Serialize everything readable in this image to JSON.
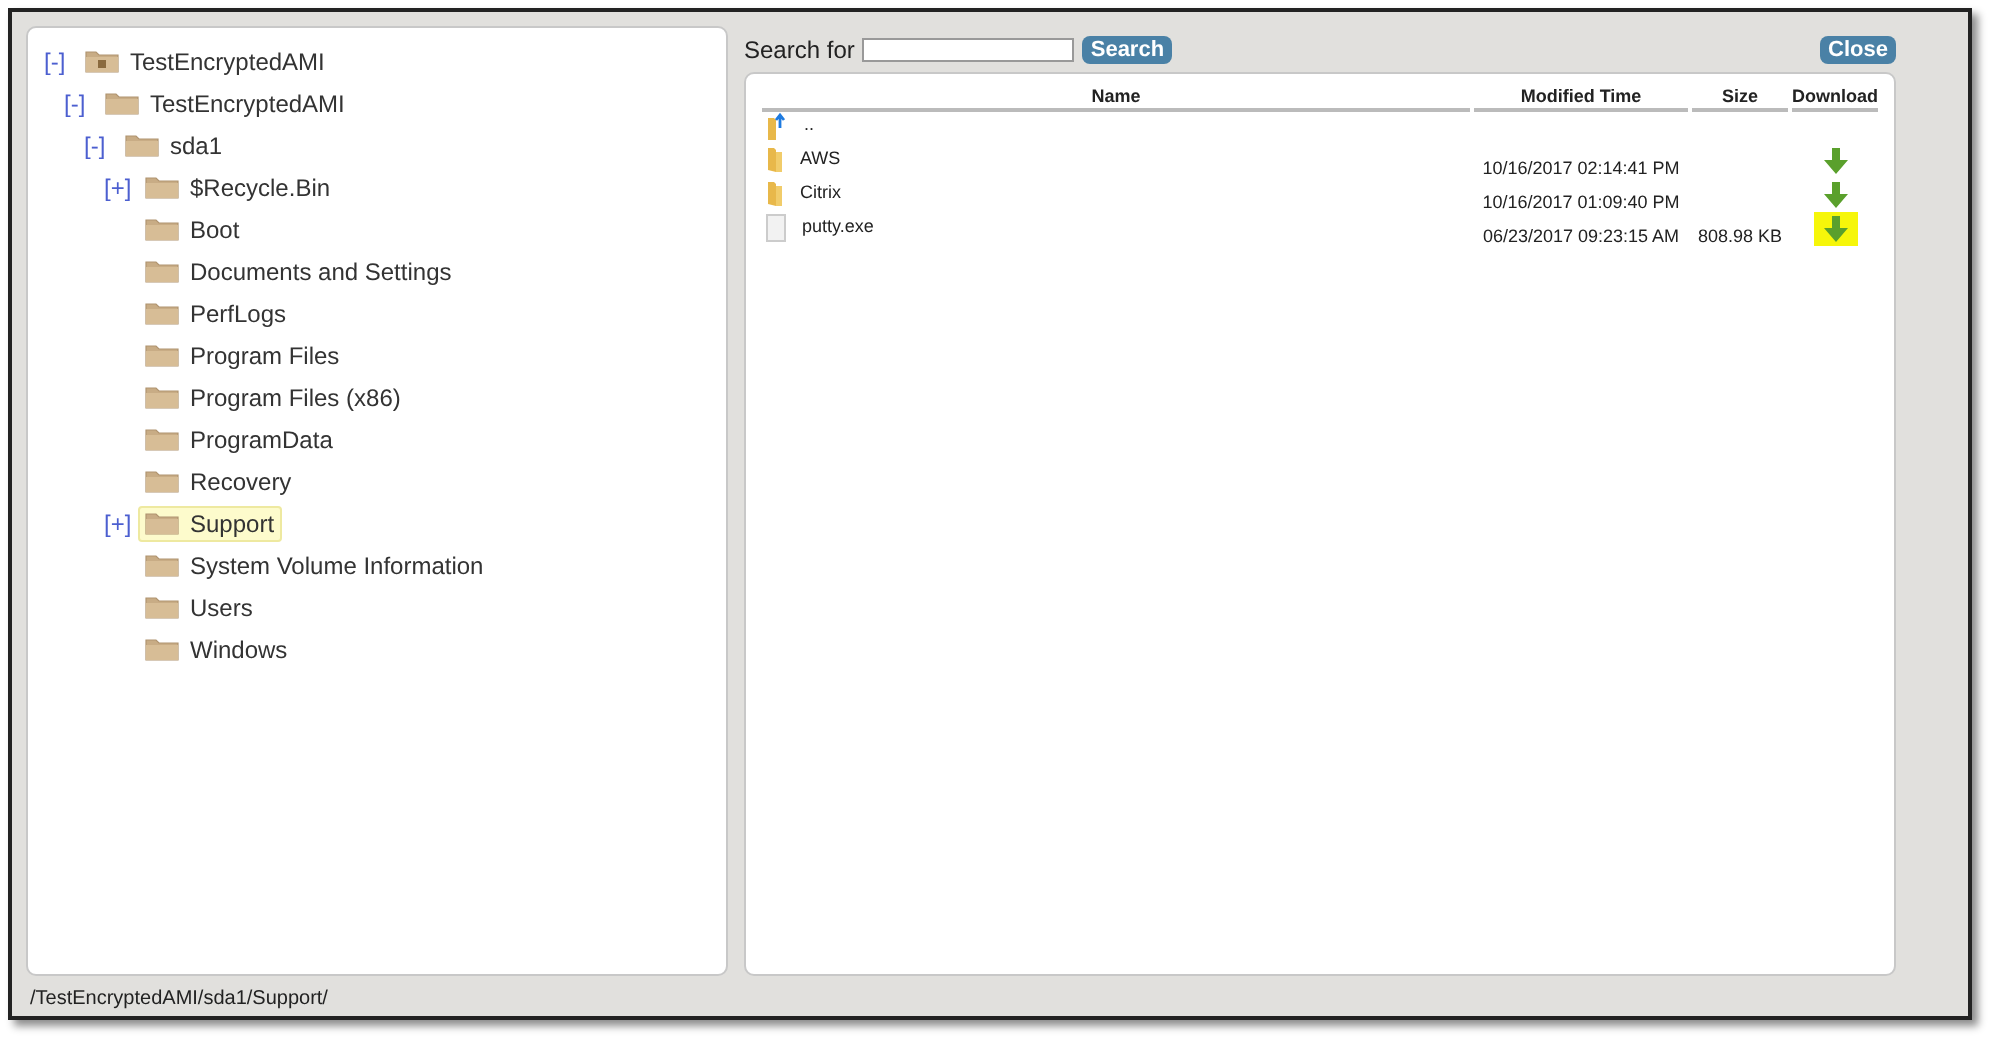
{
  "tree": [
    {
      "toggle": "[-]",
      "label": "TestEncryptedAMI",
      "selected": false,
      "children": [
        {
          "toggle": "[-]",
          "label": "TestEncryptedAMI",
          "selected": false,
          "children": [
            {
              "toggle": "[-]",
              "label": "sda1",
              "selected": false,
              "children": [
                {
                  "toggle": "[+]",
                  "label": "$Recycle.Bin",
                  "selected": false
                },
                {
                  "label": "Boot",
                  "selected": false
                },
                {
                  "label": "Documents and Settings",
                  "selected": false
                },
                {
                  "label": "PerfLogs",
                  "selected": false
                },
                {
                  "label": "Program Files",
                  "selected": false
                },
                {
                  "label": "Program Files (x86)",
                  "selected": false
                },
                {
                  "label": "ProgramData",
                  "selected": false
                },
                {
                  "label": "Recovery",
                  "selected": false
                },
                {
                  "toggle": "[+]",
                  "label": "Support",
                  "selected": true
                },
                {
                  "label": "System Volume Information",
                  "selected": false
                },
                {
                  "label": "Users",
                  "selected": false
                },
                {
                  "label": "Windows",
                  "selected": false
                }
              ]
            }
          ]
        }
      ]
    }
  ],
  "search": {
    "label": "Search for",
    "button": "Search"
  },
  "close_button": "Close",
  "table": {
    "columns": [
      "Name",
      "Modified Time",
      "Size",
      "Download"
    ],
    "rows": [
      {
        "kind": "parent",
        "name": ".."
      },
      {
        "kind": "folder",
        "name": "AWS",
        "modified": "10/16/2017 02:14:41 PM",
        "download": {
          "highlighted": false
        }
      },
      {
        "kind": "folder",
        "name": "Citrix",
        "modified": "10/16/2017 01:09:40 PM",
        "download": {
          "highlighted": false
        }
      },
      {
        "kind": "file",
        "name": "putty.exe",
        "modified": "06/23/2017 09:23:15 AM",
        "size": "808.98 KB",
        "download": {
          "highlighted": true
        }
      }
    ]
  },
  "status_path": "/TestEncryptedAMI/sda1/Support/"
}
